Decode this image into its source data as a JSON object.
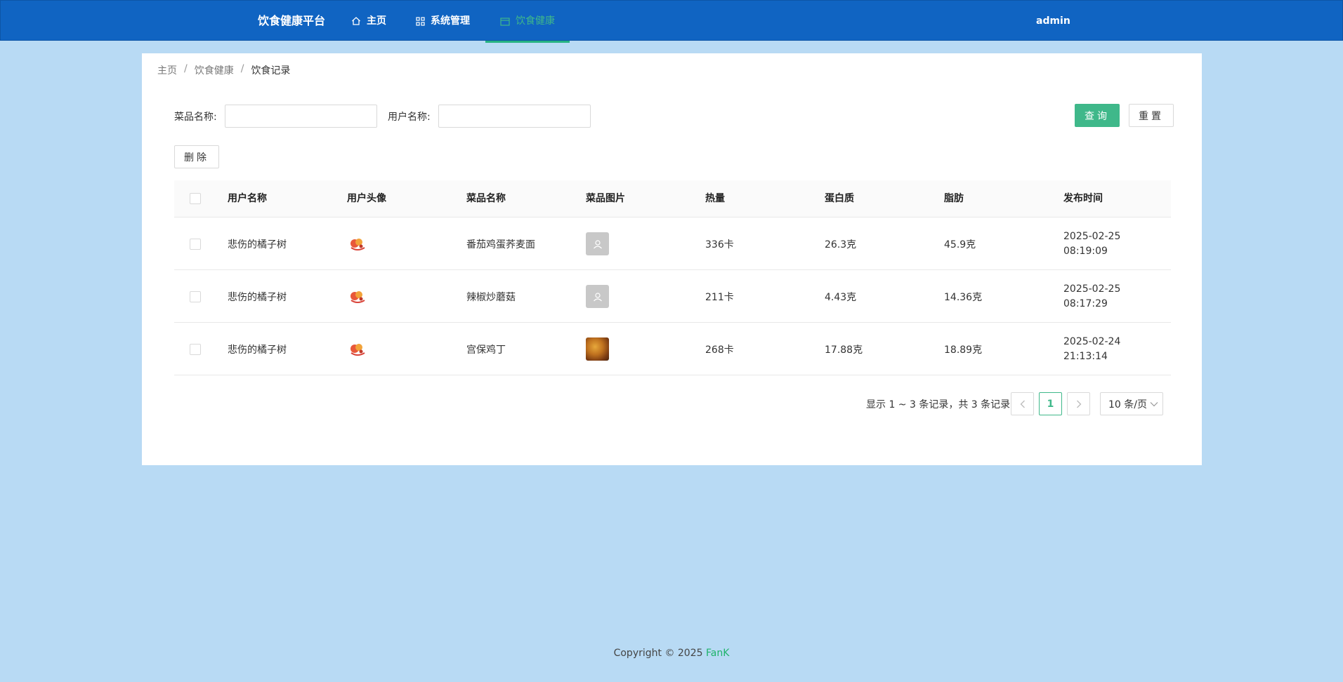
{
  "header": {
    "brand": "饮食健康平台",
    "nav": [
      {
        "label": "主页",
        "icon": "home-icon"
      },
      {
        "label": "系统管理",
        "icon": "grid-icon"
      },
      {
        "label": "饮食健康",
        "icon": "calendar-icon",
        "active": true
      }
    ],
    "user": "admin"
  },
  "breadcrumb": {
    "items": [
      "主页",
      "饮食健康",
      "饮食记录"
    ],
    "separator": "/"
  },
  "filters": {
    "dish_label": "菜品名称:",
    "dish_value": "",
    "user_label": "用户名称:",
    "user_value": ""
  },
  "buttons": {
    "query": "查询",
    "reset": "重置",
    "delete": "删除"
  },
  "table": {
    "columns": [
      "用户名称",
      "用户头像",
      "菜品名称",
      "菜品图片",
      "热量",
      "蛋白质",
      "脂肪",
      "发布时间"
    ],
    "rows": [
      {
        "user": "悲伤的橘子树",
        "dish": "番茄鸡蛋荞麦面",
        "image": "placeholder",
        "calories": "336卡",
        "protein": "26.3克",
        "fat": "45.9克",
        "date": "2025-02-25",
        "time": "08:19:09"
      },
      {
        "user": "悲伤的橘子树",
        "dish": "辣椒炒蘑菇",
        "image": "placeholder",
        "calories": "211卡",
        "protein": "4.43克",
        "fat": "14.36克",
        "date": "2025-02-25",
        "time": "08:17:29"
      },
      {
        "user": "悲伤的橘子树",
        "dish": "宫保鸡丁",
        "image": "photo",
        "calories": "268卡",
        "protein": "17.88克",
        "fat": "18.89克",
        "date": "2025-02-24",
        "time": "21:13:14"
      }
    ]
  },
  "pagination": {
    "summary": "显示 1 ~ 3 条记录，共 3 条记录",
    "current_page": "1",
    "page_size": "10 条/页"
  },
  "footer": {
    "text": "Copyright © 2025 ",
    "author": "FanK"
  },
  "colors": {
    "header_bg": "#1064c2",
    "accent": "#3fb88a",
    "page_bg": "#b8daf4"
  }
}
